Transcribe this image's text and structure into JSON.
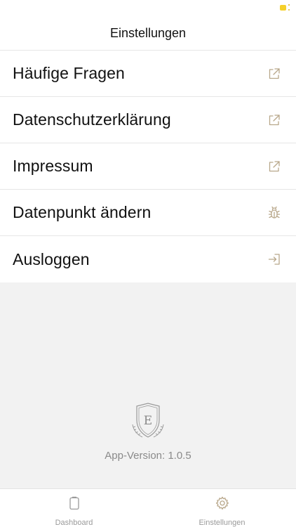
{
  "header": {
    "title": "Einstellungen"
  },
  "menu": {
    "items": [
      {
        "label": "Häufige Fragen",
        "icon": "external-link-icon"
      },
      {
        "label": "Datenschutzerklärung",
        "icon": "external-link-icon"
      },
      {
        "label": "Impressum",
        "icon": "external-link-icon"
      },
      {
        "label": "Datenpunkt ändern",
        "icon": "bug-icon"
      },
      {
        "label": "Ausloggen",
        "icon": "logout-icon"
      }
    ]
  },
  "footer": {
    "logo_letter": "E",
    "app_version": "App-Version: 1.0.5"
  },
  "tabbar": {
    "tabs": [
      {
        "label": "Dashboard",
        "icon": "clipboard-icon",
        "active": false
      },
      {
        "label": "Einstellungen",
        "icon": "gear-icon",
        "active": true
      }
    ]
  },
  "colors": {
    "icon_tan": "#b8a78a",
    "background": "#f2f2f2",
    "battery": "#f5d02a"
  }
}
